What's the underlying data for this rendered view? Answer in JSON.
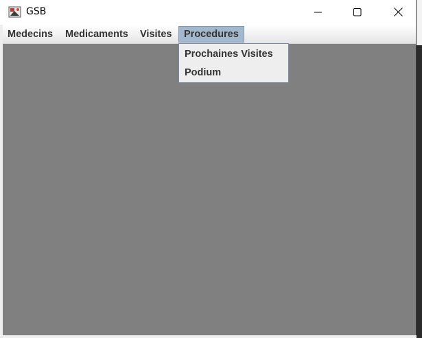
{
  "window": {
    "title": "GSB",
    "icon": "app-icon"
  },
  "controls": {
    "minimize_icon": "minimize-icon",
    "maximize_icon": "maximize-icon",
    "close_icon": "close-icon"
  },
  "menubar": {
    "items": [
      {
        "label": "Medecins"
      },
      {
        "label": "Medicaments"
      },
      {
        "label": "Visites"
      },
      {
        "label": "Procedures",
        "active": true
      }
    ]
  },
  "dropdown": {
    "items": [
      {
        "label": "Prochaines Visites"
      },
      {
        "label": "Podium"
      }
    ]
  },
  "colors": {
    "content_bg": "#808080",
    "menu_selected_bg": "#a3b8cc",
    "dropdown_bg": "#eeeeee"
  }
}
